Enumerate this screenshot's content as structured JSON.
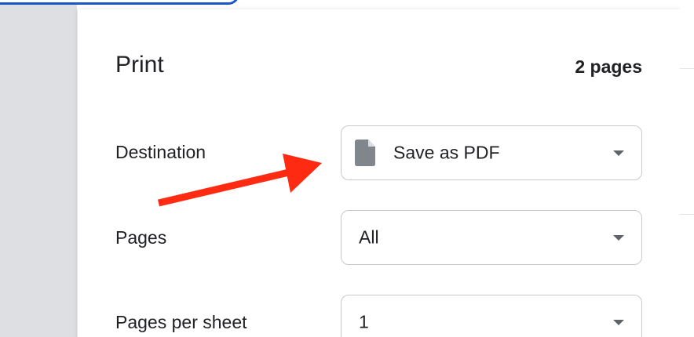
{
  "dialog": {
    "title": "Print",
    "page_count": "2 pages"
  },
  "settings": [
    {
      "label": "Destination",
      "value": "Save as PDF",
      "icon": "file-icon"
    },
    {
      "label": "Pages",
      "value": "All"
    },
    {
      "label": "Pages per sheet",
      "value": "1"
    }
  ],
  "annotation": {
    "arrow_color": "#ff2a12"
  },
  "colors": {
    "backdrop": "#dedfe3",
    "accent_outline": "#1a56c8",
    "text": "#202124",
    "icon": "#80868b"
  }
}
